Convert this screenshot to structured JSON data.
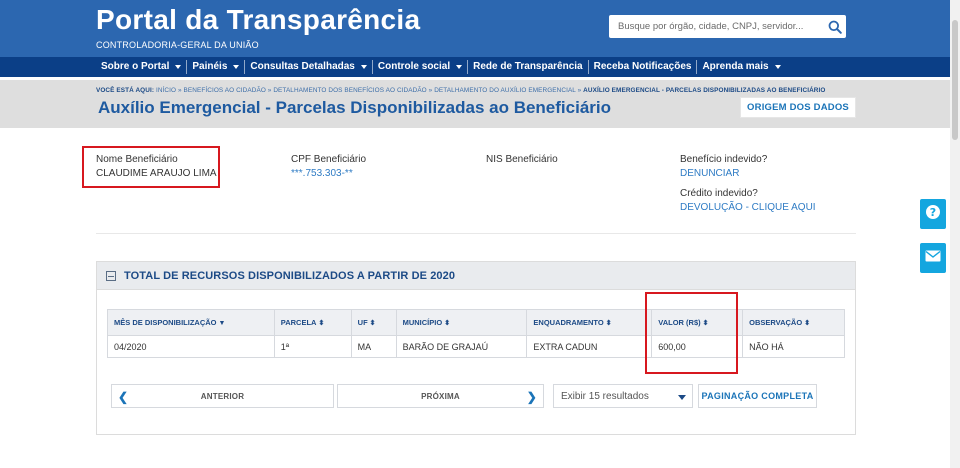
{
  "header": {
    "title": "Portal da Transparência",
    "subtitle": "CONTROLADORIA-GERAL DA UNIÃO",
    "search_placeholder": "Busque por órgão, cidade, CNPJ, servidor...",
    "search_icon": "search-icon",
    "bg_color": "#2c67b0"
  },
  "nav": {
    "bg_color": "#0b3f87",
    "items": [
      {
        "label": "Sobre o Portal",
        "dropdown": true
      },
      {
        "label": "Painéis",
        "dropdown": true
      },
      {
        "label": "Consultas Detalhadas",
        "dropdown": true
      },
      {
        "label": "Controle social",
        "dropdown": true
      },
      {
        "label": "Rede de Transparência",
        "dropdown": false
      },
      {
        "label": "Receba Notificações",
        "dropdown": false
      },
      {
        "label": "Aprenda mais",
        "dropdown": true
      }
    ]
  },
  "breadcrumb": {
    "prefix": "VOCÊ ESTÁ AQUI:",
    "items": [
      "INÍCIO",
      "BENEFÍCIOS AO CIDADÃO",
      "DETALHAMENTO DOS BENEFÍCIOS AO CIDADÃO",
      "DETALHAMENTO DO AUXÍLIO EMERGENCIAL"
    ],
    "current": "AUXÍLIO EMERGENCIAL - PARCELAS DISPONIBILIZADAS AO BENEFICIÁRIO",
    "separator": "»"
  },
  "page": {
    "title": "Auxílio Emergencial - Parcelas Disponibilizadas ao Beneficiário",
    "origem_button": "ORIGEM DOS DADOS"
  },
  "beneficiary": {
    "name_label": "Nome Beneficiário",
    "name_value": "CLAUDIME ARAUJO LIMA",
    "cpf_label": "CPF Beneficiário",
    "cpf_value": "***.753.303-**",
    "nis_label": "NIS Beneficiário",
    "beneficio_label": "Benefício indevido?",
    "beneficio_link": "DENUNCIAR",
    "credito_label": "Crédito indevido?",
    "credito_link": "DEVOLUÇÃO - CLIQUE AQUI"
  },
  "panel": {
    "title": "TOTAL DE RECURSOS DISPONIBILIZADOS A PARTIR DE 2020",
    "columns": [
      {
        "label": "MÊS DE DISPONIBILIZAÇÃO",
        "sort": "▼"
      },
      {
        "label": "PARCELA",
        "sort": "⬍"
      },
      {
        "label": "UF",
        "sort": "⬍"
      },
      {
        "label": "MUNICÍPIO",
        "sort": "⬍"
      },
      {
        "label": "ENQUADRAMENTO",
        "sort": "⬍"
      },
      {
        "label": "VALOR (R$)",
        "sort": "⬍"
      },
      {
        "label": "OBSERVAÇÃO",
        "sort": "⬍"
      }
    ],
    "rows": [
      [
        "04/2020",
        "1ª",
        "MA",
        "BARÃO DE GRAJAÚ",
        "EXTRA CADUN",
        "600,00",
        "NÃO HÁ"
      ]
    ]
  },
  "pagination": {
    "prev_label": "ANTERIOR",
    "next_label": "PRÓXIMA",
    "prev_arrow": "❮",
    "next_arrow": "❯",
    "results_selected": "Exibir 15 resultados",
    "complete_label": "PAGINAÇÃO COMPLETA"
  },
  "side_buttons": [
    {
      "icon": "question-icon",
      "color": "#14a6df"
    },
    {
      "icon": "envelope-icon",
      "color": "#14a6df"
    }
  ],
  "highlight_color": "#d7181f"
}
